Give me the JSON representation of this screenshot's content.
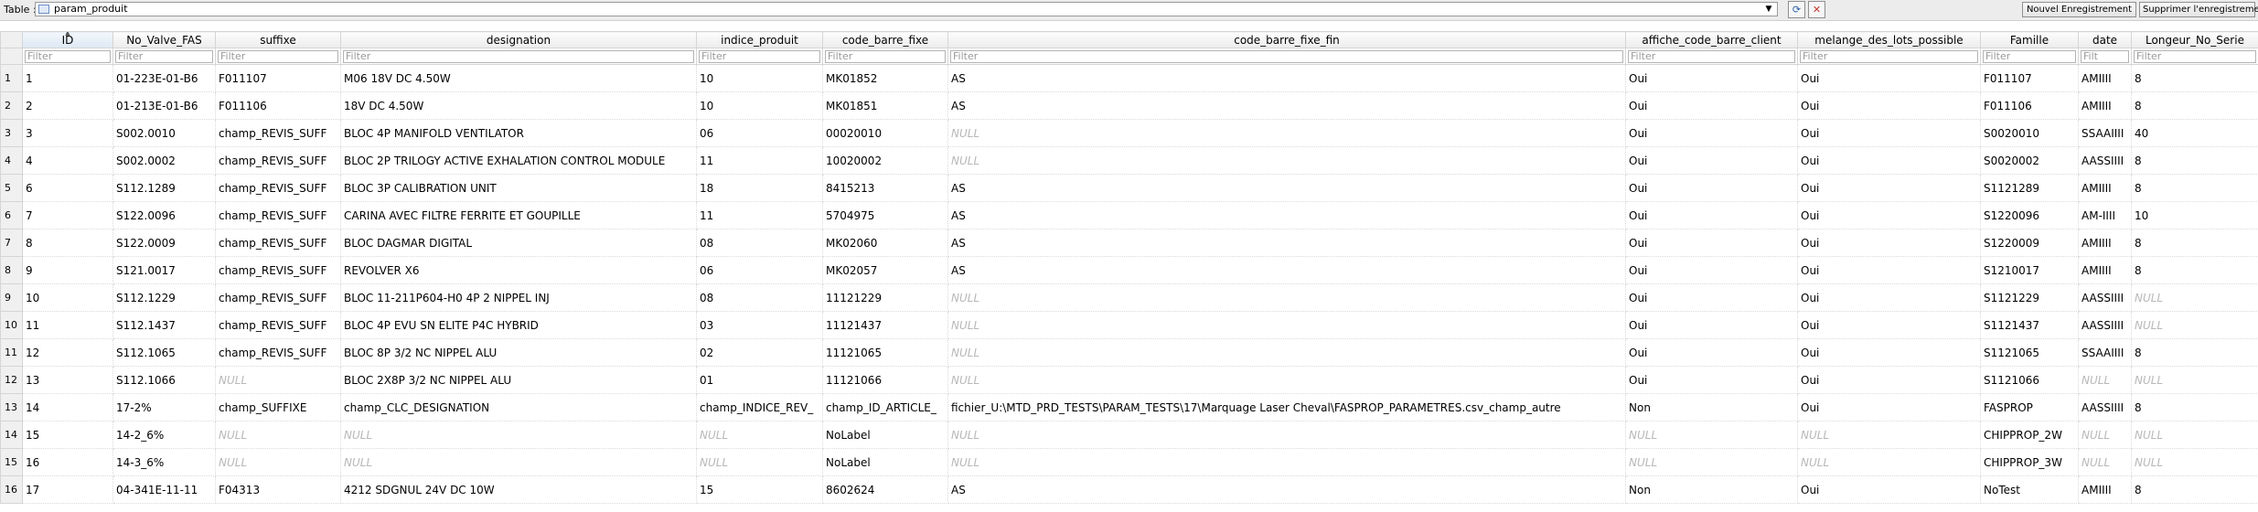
{
  "toolbar": {
    "table_label": "Table :",
    "table_value": "param_produit",
    "new_record": "Nouvel Enregistrement",
    "delete_record": "Supprimer l'enregistrement"
  },
  "filter_placeholder": "Filter",
  "columns": [
    "ID",
    "No_Valve_FAS",
    "suffixe",
    "designation",
    "indice_produit",
    "code_barre_fixe",
    "code_barre_fixe_fin",
    "affiche_code_barre_client",
    "melange_des_lots_possible",
    "Famille",
    "date",
    "Longeur_No_Serie"
  ],
  "filter_values": [
    "Filter",
    "Filter",
    "Filter",
    "Filter",
    "Filter",
    "Filter",
    "Filter",
    "Filter",
    "Filter",
    "Filter",
    "Filt",
    "Filter"
  ],
  "rows": [
    [
      "1",
      "1",
      "01-223E-01-B6",
      "F011107",
      "M06    18V DC   4.50W",
      "10",
      "MK01852",
      "AS",
      "Oui",
      "Oui",
      "F011107",
      "AMIIII",
      "8"
    ],
    [
      "2",
      "2",
      "01-213E-01-B6",
      "F011106",
      "18V DC   4.50W",
      "10",
      "MK01851",
      "AS",
      "Oui",
      "Oui",
      "F011106",
      "AMIIII",
      "8"
    ],
    [
      "3",
      "3",
      "S002.0010",
      "champ_REVIS_SUFF",
      "BLOC 4P MANIFOLD VENTILATOR",
      "06",
      "00020010",
      "NULL",
      "Oui",
      "Oui",
      "S0020010",
      "SSAAIIII",
      "40"
    ],
    [
      "4",
      "4",
      "S002.0002",
      "champ_REVIS_SUFF",
      "BLOC 2P TRILOGY ACTIVE EXHALATION CONTROL MODULE",
      "11",
      "10020002",
      "NULL",
      "Oui",
      "Oui",
      "S0020002",
      "AASSIIII",
      "8"
    ],
    [
      "5",
      "6",
      "S112.1289",
      "champ_REVIS_SUFF",
      "BLOC 3P CALIBRATION UNIT",
      "18",
      "8415213",
      "AS",
      "Oui",
      "Oui",
      "S1121289",
      "AMIIII",
      "8"
    ],
    [
      "6",
      "7",
      "S122.0096",
      "champ_REVIS_SUFF",
      "CARINA  AVEC FILTRE FERRITE ET GOUPILLE",
      "11",
      "5704975",
      "AS",
      "Oui",
      "Oui",
      "S1220096",
      "AM-IIII",
      "10"
    ],
    [
      "7",
      "8",
      "S122.0009",
      "champ_REVIS_SUFF",
      "BLOC DAGMAR DIGITAL",
      "08",
      "MK02060",
      "AS",
      "Oui",
      "Oui",
      "S1220009",
      "AMIIII",
      "8"
    ],
    [
      "8",
      "9",
      "S121.0017",
      "champ_REVIS_SUFF",
      "REVOLVER X6",
      "06",
      "MK02057",
      "AS",
      "Oui",
      "Oui",
      "S1210017",
      "AMIIII",
      "8"
    ],
    [
      "9",
      "10",
      "S112.1229",
      "champ_REVIS_SUFF",
      "BLOC 11-211P604-H0 4P 2 NIPPEL INJ",
      "08",
      "11121229",
      "NULL",
      "Oui",
      "Oui",
      "S1121229",
      "AASSIIII",
      "NULL"
    ],
    [
      "10",
      "11",
      "S112.1437",
      "champ_REVIS_SUFF",
      "BLOC 4P EVU SN ELITE P4C HYBRID",
      "03",
      "11121437",
      "NULL",
      "Oui",
      "Oui",
      "S1121437",
      "AASSIIII",
      "NULL"
    ],
    [
      "11",
      "12",
      "S112.1065",
      "champ_REVIS_SUFF",
      "BLOC 8P 3/2 NC NIPPEL ALU",
      "02",
      "11121065",
      "NULL",
      "Oui",
      "Oui",
      "S1121065",
      "SSAAIIII",
      "8"
    ],
    [
      "12",
      "13",
      "S112.1066",
      "NULL",
      "BLOC 2X8P 3/2 NC NIPPEL ALU",
      "01",
      "11121066",
      "NULL",
      "Oui",
      "Oui",
      "S1121066",
      "NULL",
      "NULL"
    ],
    [
      "13",
      "14",
      "17-2%",
      "champ_SUFFIXE",
      "champ_CLC_DESIGNATION",
      "champ_INDICE_REV_",
      "champ_ID_ARTICLE_",
      "fichier_U:\\MTD_PRD_TESTS\\PARAM_TESTS\\17\\Marquage Laser Cheval\\FASPROP_PARAMETRES.csv_champ_autre",
      "Non",
      "Oui",
      "FASPROP",
      "AASSIIII",
      "8"
    ],
    [
      "14",
      "15",
      "14-2_6%",
      "NULL",
      "NULL",
      "NULL",
      "NoLabel",
      "NULL",
      "NULL",
      "NULL",
      "CHIPPROP_2W",
      "NULL",
      "NULL"
    ],
    [
      "15",
      "16",
      "14-3_6%",
      "NULL",
      "NULL",
      "NULL",
      "NoLabel",
      "NULL",
      "NULL",
      "NULL",
      "CHIPPROP_3W",
      "NULL",
      "NULL"
    ],
    [
      "16",
      "17",
      "04-341E-11-11",
      "F04313",
      "4212 SDGNUL  24V DC  10W",
      "15",
      "8602624",
      "AS",
      "Non",
      "Oui",
      "NoTest",
      "AMIIII",
      "8"
    ]
  ]
}
